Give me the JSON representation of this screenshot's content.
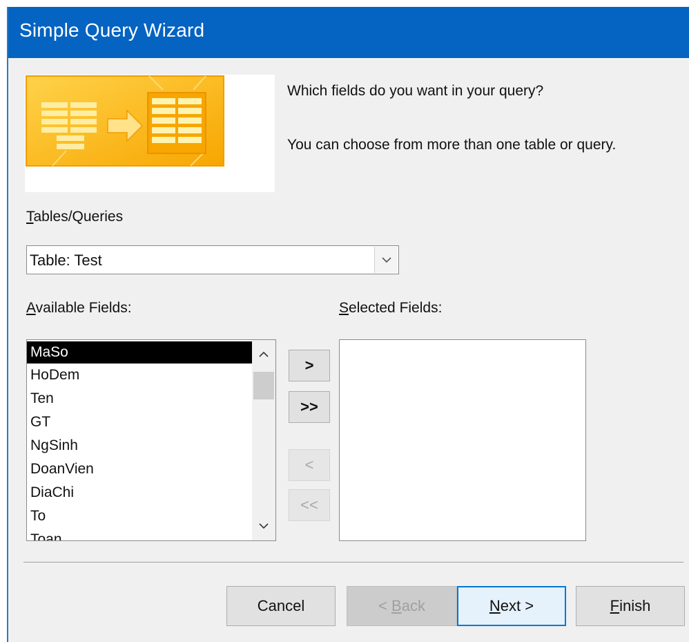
{
  "window": {
    "title": "Simple Query Wizard"
  },
  "header": {
    "question": "Which fields do you want in your query?",
    "hint": "You can choose from more than one table or query."
  },
  "tables_queries": {
    "label_hotkey": "T",
    "label_rest": "ables/Queries",
    "selected_value": "Table: Test",
    "dropdown_icon": "chevron-down-icon"
  },
  "available_fields": {
    "label_hotkey": "A",
    "label_rest": "vailable Fields:",
    "items": [
      "MaSo",
      "HoDem",
      "Ten",
      "GT",
      "NgSinh",
      "DoanVien",
      "DiaChi",
      "To",
      "Toan"
    ],
    "selected_item": "MaSo"
  },
  "selected_fields": {
    "label_hotkey": "S",
    "label_rest": "elected Fields:",
    "items": []
  },
  "move_buttons": {
    "add_one": ">",
    "add_all": ">>",
    "remove_one": "<",
    "remove_all": "<<"
  },
  "footer": {
    "cancel": "Cancel",
    "back_prefix": "< ",
    "back_hotkey": "B",
    "back_rest": "ack",
    "next_hotkey": "N",
    "next_rest": "ext >",
    "finish_hotkey": "F",
    "finish_rest": "inish"
  },
  "colors": {
    "titlebar": "#0563c1",
    "selection": "#000000",
    "default_button_border": "#0078d7",
    "wizard_graphic": "#ffc000"
  }
}
